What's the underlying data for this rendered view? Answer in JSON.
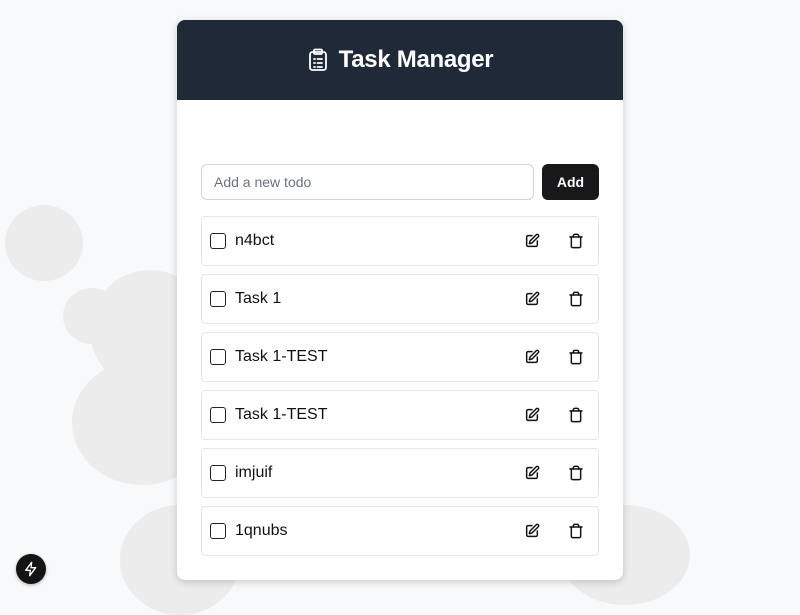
{
  "header": {
    "title": "Task Manager",
    "icon": "clipboard-icon"
  },
  "add_form": {
    "placeholder": "Add a new todo",
    "value": "",
    "button_label": "Add"
  },
  "todos": [
    {
      "text": "n4bct",
      "completed": false
    },
    {
      "text": "Task 1",
      "completed": false
    },
    {
      "text": "Task 1-TEST",
      "completed": false
    },
    {
      "text": "Task 1-TEST",
      "completed": false
    },
    {
      "text": "imjuif",
      "completed": false
    },
    {
      "text": "1qnubs",
      "completed": false
    }
  ],
  "colors": {
    "header_bg": "#1f2937",
    "button_bg": "#18181b",
    "page_bg": "#f8f9fa"
  },
  "icons": {
    "edit": "edit-icon",
    "delete": "trash-icon",
    "fab": "lightning-icon"
  }
}
